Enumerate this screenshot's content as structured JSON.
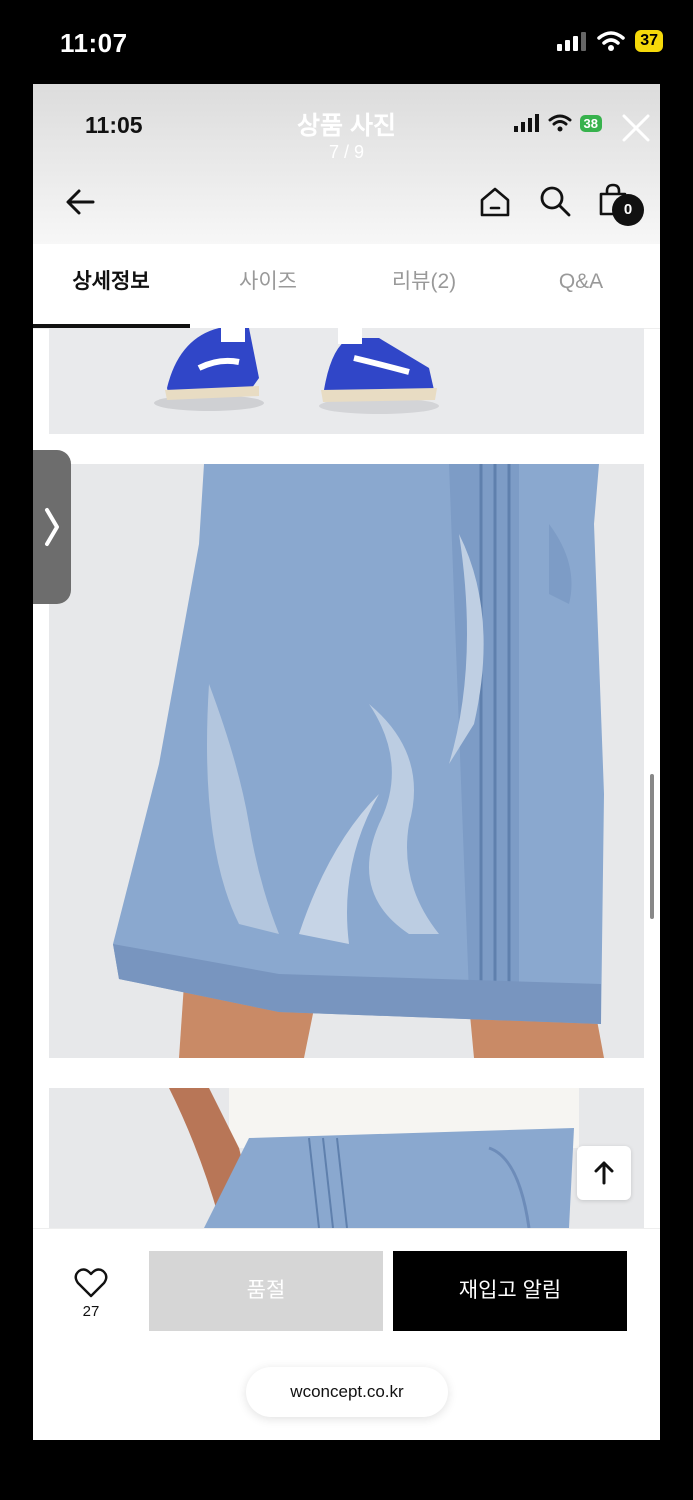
{
  "outer_status": {
    "time": "11:07",
    "battery": "37"
  },
  "viewer": {
    "title": "상품 사진",
    "count": "7 / 9",
    "inner_time": "11:05",
    "inner_battery": "38"
  },
  "header": {
    "cart_count": "0"
  },
  "tabs": [
    {
      "label": "상세정보",
      "active": true
    },
    {
      "label": "사이즈",
      "active": false
    },
    {
      "label": "리뷰(2)",
      "active": false
    },
    {
      "label": "Q&A",
      "active": false
    }
  ],
  "bottom_bar": {
    "like_count": "27",
    "sold_out_label": "품절",
    "notify_label": "재입고 알림"
  },
  "browser": {
    "url": "wconcept.co.kr"
  },
  "colors": {
    "shoe_blue": "#3046c8",
    "denim": "#8aa8cf",
    "dark": "#000000"
  }
}
